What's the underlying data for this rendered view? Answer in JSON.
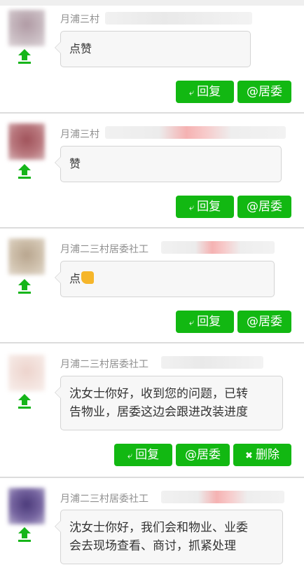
{
  "labels": {
    "reply": "回复",
    "reply_icon": "reply-arrow-icon",
    "mention": "@居委",
    "delete": "删除",
    "delete_icon": "x-circle-icon",
    "upvote_icon": "upvote-arrow-icon"
  },
  "colors": {
    "accent_green": "#12b812",
    "name_gray": "#8f8f8f",
    "bubble_bg": "#f7f7f7",
    "separator": "#dcdcdc"
  },
  "comments": [
    {
      "author": "月浦三村",
      "text": "点赞",
      "emoji": ""
    },
    {
      "author": "月浦三村",
      "text": "赞",
      "emoji": ""
    },
    {
      "author": "月浦二三村居委社工",
      "text": "点",
      "emoji": "thumbs-up-emoji"
    },
    {
      "author": "月浦二三村居委社工",
      "text_line1": "沈女士你好，收到您的问题，已转",
      "text_line2": "告物业，居委这边会跟进改装进度"
    },
    {
      "author": "月浦二三村居委社工",
      "text_line1": "沈女士你好，我们会和物业、业委",
      "text_line2": "会去现场查看、商讨，抓紧处理"
    }
  ]
}
